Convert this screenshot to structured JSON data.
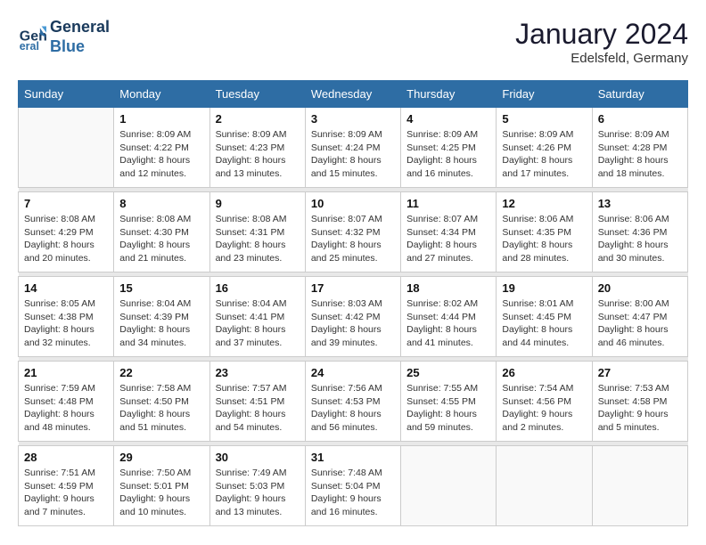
{
  "header": {
    "logo_line1": "General",
    "logo_line2": "Blue",
    "month_title": "January 2024",
    "location": "Edelsfeld, Germany"
  },
  "days_of_week": [
    "Sunday",
    "Monday",
    "Tuesday",
    "Wednesday",
    "Thursday",
    "Friday",
    "Saturday"
  ],
  "weeks": [
    [
      {
        "day": "",
        "info": ""
      },
      {
        "day": "1",
        "info": "Sunrise: 8:09 AM\nSunset: 4:22 PM\nDaylight: 8 hours\nand 12 minutes."
      },
      {
        "day": "2",
        "info": "Sunrise: 8:09 AM\nSunset: 4:23 PM\nDaylight: 8 hours\nand 13 minutes."
      },
      {
        "day": "3",
        "info": "Sunrise: 8:09 AM\nSunset: 4:24 PM\nDaylight: 8 hours\nand 15 minutes."
      },
      {
        "day": "4",
        "info": "Sunrise: 8:09 AM\nSunset: 4:25 PM\nDaylight: 8 hours\nand 16 minutes."
      },
      {
        "day": "5",
        "info": "Sunrise: 8:09 AM\nSunset: 4:26 PM\nDaylight: 8 hours\nand 17 minutes."
      },
      {
        "day": "6",
        "info": "Sunrise: 8:09 AM\nSunset: 4:28 PM\nDaylight: 8 hours\nand 18 minutes."
      }
    ],
    [
      {
        "day": "7",
        "info": "Sunrise: 8:08 AM\nSunset: 4:29 PM\nDaylight: 8 hours\nand 20 minutes."
      },
      {
        "day": "8",
        "info": "Sunrise: 8:08 AM\nSunset: 4:30 PM\nDaylight: 8 hours\nand 21 minutes."
      },
      {
        "day": "9",
        "info": "Sunrise: 8:08 AM\nSunset: 4:31 PM\nDaylight: 8 hours\nand 23 minutes."
      },
      {
        "day": "10",
        "info": "Sunrise: 8:07 AM\nSunset: 4:32 PM\nDaylight: 8 hours\nand 25 minutes."
      },
      {
        "day": "11",
        "info": "Sunrise: 8:07 AM\nSunset: 4:34 PM\nDaylight: 8 hours\nand 27 minutes."
      },
      {
        "day": "12",
        "info": "Sunrise: 8:06 AM\nSunset: 4:35 PM\nDaylight: 8 hours\nand 28 minutes."
      },
      {
        "day": "13",
        "info": "Sunrise: 8:06 AM\nSunset: 4:36 PM\nDaylight: 8 hours\nand 30 minutes."
      }
    ],
    [
      {
        "day": "14",
        "info": "Sunrise: 8:05 AM\nSunset: 4:38 PM\nDaylight: 8 hours\nand 32 minutes."
      },
      {
        "day": "15",
        "info": "Sunrise: 8:04 AM\nSunset: 4:39 PM\nDaylight: 8 hours\nand 34 minutes."
      },
      {
        "day": "16",
        "info": "Sunrise: 8:04 AM\nSunset: 4:41 PM\nDaylight: 8 hours\nand 37 minutes."
      },
      {
        "day": "17",
        "info": "Sunrise: 8:03 AM\nSunset: 4:42 PM\nDaylight: 8 hours\nand 39 minutes."
      },
      {
        "day": "18",
        "info": "Sunrise: 8:02 AM\nSunset: 4:44 PM\nDaylight: 8 hours\nand 41 minutes."
      },
      {
        "day": "19",
        "info": "Sunrise: 8:01 AM\nSunset: 4:45 PM\nDaylight: 8 hours\nand 44 minutes."
      },
      {
        "day": "20",
        "info": "Sunrise: 8:00 AM\nSunset: 4:47 PM\nDaylight: 8 hours\nand 46 minutes."
      }
    ],
    [
      {
        "day": "21",
        "info": "Sunrise: 7:59 AM\nSunset: 4:48 PM\nDaylight: 8 hours\nand 48 minutes."
      },
      {
        "day": "22",
        "info": "Sunrise: 7:58 AM\nSunset: 4:50 PM\nDaylight: 8 hours\nand 51 minutes."
      },
      {
        "day": "23",
        "info": "Sunrise: 7:57 AM\nSunset: 4:51 PM\nDaylight: 8 hours\nand 54 minutes."
      },
      {
        "day": "24",
        "info": "Sunrise: 7:56 AM\nSunset: 4:53 PM\nDaylight: 8 hours\nand 56 minutes."
      },
      {
        "day": "25",
        "info": "Sunrise: 7:55 AM\nSunset: 4:55 PM\nDaylight: 8 hours\nand 59 minutes."
      },
      {
        "day": "26",
        "info": "Sunrise: 7:54 AM\nSunset: 4:56 PM\nDaylight: 9 hours\nand 2 minutes."
      },
      {
        "day": "27",
        "info": "Sunrise: 7:53 AM\nSunset: 4:58 PM\nDaylight: 9 hours\nand 5 minutes."
      }
    ],
    [
      {
        "day": "28",
        "info": "Sunrise: 7:51 AM\nSunset: 4:59 PM\nDaylight: 9 hours\nand 7 minutes."
      },
      {
        "day": "29",
        "info": "Sunrise: 7:50 AM\nSunset: 5:01 PM\nDaylight: 9 hours\nand 10 minutes."
      },
      {
        "day": "30",
        "info": "Sunrise: 7:49 AM\nSunset: 5:03 PM\nDaylight: 9 hours\nand 13 minutes."
      },
      {
        "day": "31",
        "info": "Sunrise: 7:48 AM\nSunset: 5:04 PM\nDaylight: 9 hours\nand 16 minutes."
      },
      {
        "day": "",
        "info": ""
      },
      {
        "day": "",
        "info": ""
      },
      {
        "day": "",
        "info": ""
      }
    ]
  ]
}
